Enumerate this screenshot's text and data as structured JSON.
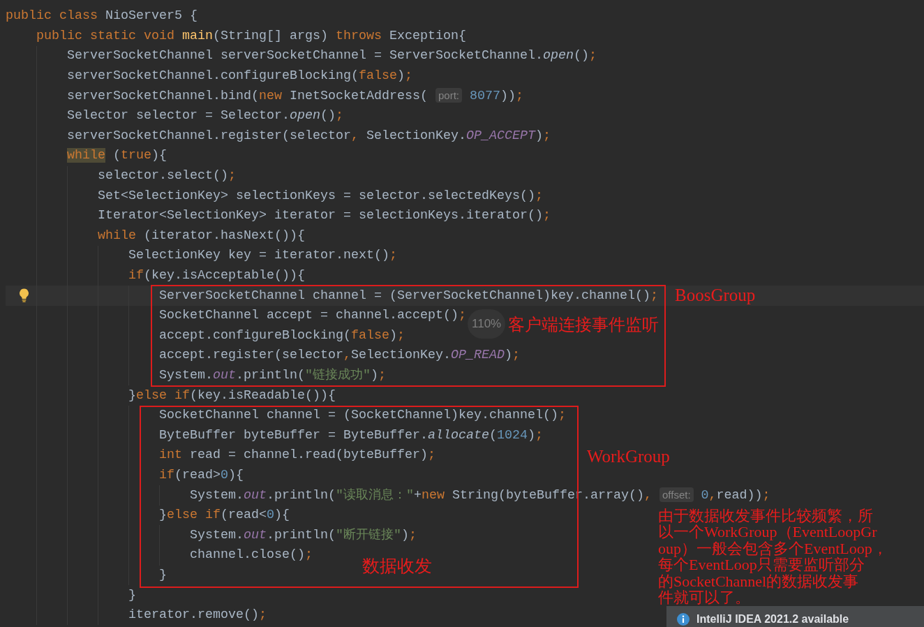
{
  "editor": {
    "lines": [
      {
        "current": false,
        "tokens": [
          {
            "kind": "keyword",
            "text": "public class"
          },
          {
            "kind": "plain",
            "text": " NioServer5 {"
          }
        ],
        "children": [
          {
            "current": false,
            "tokens": [
              {
                "kind": "keyword",
                "text": "public static void"
              },
              {
                "kind": "declaration",
                "text": " main"
              },
              {
                "kind": "plain",
                "text": "(String[] args) "
              },
              {
                "kind": "keyword",
                "text": "throws"
              },
              {
                "kind": "plain",
                "text": " Exception{"
              }
            ],
            "children": [
              {
                "current": false,
                "tokens": [
                  {
                    "kind": "plain",
                    "text": "ServerSocketChannel serverSocketChannel = ServerSocketChannel."
                  },
                  {
                    "kind": "static_call",
                    "text": "open"
                  },
                  {
                    "kind": "plain",
                    "text": "()"
                  },
                  {
                    "kind": "separator",
                    "text": ";"
                  }
                ]
              },
              {
                "current": false,
                "tokens": [
                  {
                    "kind": "plain",
                    "text": "serverSocketChannel.configureBlocking("
                  },
                  {
                    "kind": "keyword",
                    "text": "false"
                  },
                  {
                    "kind": "plain",
                    "text": ")"
                  },
                  {
                    "kind": "separator",
                    "text": ";"
                  }
                ]
              },
              {
                "current": false,
                "tokens": [
                  {
                    "kind": "plain",
                    "text": "serverSocketChannel.bind("
                  },
                  {
                    "kind": "keyword",
                    "text": "new"
                  },
                  {
                    "kind": "plain",
                    "text": " InetSocketAddress( "
                  },
                  {
                    "kind": "hint",
                    "text": "port:"
                  },
                  {
                    "kind": "number",
                    "text": " 8077"
                  },
                  {
                    "kind": "plain",
                    "text": "))"
                  },
                  {
                    "kind": "separator",
                    "text": ";"
                  }
                ]
              },
              {
                "current": false,
                "tokens": [
                  {
                    "kind": "plain",
                    "text": "Selector selector = Selector."
                  },
                  {
                    "kind": "static_call",
                    "text": "open"
                  },
                  {
                    "kind": "plain",
                    "text": "()"
                  },
                  {
                    "kind": "separator",
                    "text": ";"
                  }
                ]
              },
              {
                "current": false,
                "tokens": [
                  {
                    "kind": "plain",
                    "text": "serverSocketChannel.register(selector"
                  },
                  {
                    "kind": "separator",
                    "text": ","
                  },
                  {
                    "kind": "plain",
                    "text": " SelectionKey."
                  },
                  {
                    "kind": "field",
                    "text": "OP_ACCEPT"
                  },
                  {
                    "kind": "plain",
                    "text": ")"
                  },
                  {
                    "kind": "separator",
                    "text": ";"
                  }
                ]
              },
              {
                "current": false,
                "tokens": [
                  {
                    "kind": "keyword_marked",
                    "text": "while"
                  },
                  {
                    "kind": "plain",
                    "text": " ("
                  },
                  {
                    "kind": "keyword",
                    "text": "true"
                  },
                  {
                    "kind": "plain",
                    "text": "){"
                  }
                ],
                "children": [
                  {
                    "current": false,
                    "tokens": [
                      {
                        "kind": "plain",
                        "text": "selector.select()"
                      },
                      {
                        "kind": "separator",
                        "text": ";"
                      }
                    ]
                  },
                  {
                    "current": false,
                    "tokens": [
                      {
                        "kind": "plain",
                        "text": "Set<SelectionKey> selectionKeys = selector.selectedKeys()"
                      },
                      {
                        "kind": "separator",
                        "text": ";"
                      }
                    ]
                  },
                  {
                    "current": false,
                    "tokens": [
                      {
                        "kind": "plain",
                        "text": "Iterator<SelectionKey> iterator = selectionKeys.iterator()"
                      },
                      {
                        "kind": "separator",
                        "text": ";"
                      }
                    ]
                  },
                  {
                    "current": false,
                    "tokens": [
                      {
                        "kind": "keyword",
                        "text": "while"
                      },
                      {
                        "kind": "plain",
                        "text": " (iterator.hasNext()){"
                      }
                    ],
                    "children": [
                      {
                        "current": false,
                        "tokens": [
                          {
                            "kind": "plain",
                            "text": "SelectionKey key = iterator.next()"
                          },
                          {
                            "kind": "separator",
                            "text": ";"
                          }
                        ]
                      },
                      {
                        "current": false,
                        "tokens": [
                          {
                            "kind": "keyword",
                            "text": "if"
                          },
                          {
                            "kind": "plain",
                            "text": "(key.isAcceptable()){"
                          }
                        ],
                        "children": [
                          {
                            "current": true,
                            "tokens": [
                              {
                                "kind": "plain",
                                "text": "ServerSocketChannel channel = (ServerSocketChannel)key.channel()"
                              },
                              {
                                "kind": "separator",
                                "text": ";"
                              }
                            ]
                          },
                          {
                            "current": false,
                            "tokens": [
                              {
                                "kind": "plain",
                                "text": "SocketChannel accept = channel.accept()"
                              },
                              {
                                "kind": "separator",
                                "text": ";"
                              }
                            ]
                          },
                          {
                            "current": false,
                            "tokens": [
                              {
                                "kind": "plain",
                                "text": "accept.configureBlocking("
                              },
                              {
                                "kind": "keyword",
                                "text": "false"
                              },
                              {
                                "kind": "plain",
                                "text": ")"
                              },
                              {
                                "kind": "separator",
                                "text": ";"
                              }
                            ]
                          },
                          {
                            "current": false,
                            "tokens": [
                              {
                                "kind": "plain",
                                "text": "accept.register(selector"
                              },
                              {
                                "kind": "separator",
                                "text": ","
                              },
                              {
                                "kind": "plain",
                                "text": "SelectionKey."
                              },
                              {
                                "kind": "field",
                                "text": "OP_READ"
                              },
                              {
                                "kind": "plain",
                                "text": ")"
                              },
                              {
                                "kind": "separator",
                                "text": ";"
                              }
                            ]
                          },
                          {
                            "current": false,
                            "tokens": [
                              {
                                "kind": "plain",
                                "text": "System."
                              },
                              {
                                "kind": "field",
                                "text": "out"
                              },
                              {
                                "kind": "plain",
                                "text": ".println("
                              },
                              {
                                "kind": "string",
                                "text": "\"链接成功\""
                              },
                              {
                                "kind": "plain",
                                "text": ")"
                              },
                              {
                                "kind": "separator",
                                "text": ";"
                              }
                            ]
                          }
                        ]
                      },
                      {
                        "current": false,
                        "tokens": [
                          {
                            "kind": "plain",
                            "text": "}"
                          },
                          {
                            "kind": "keyword",
                            "text": "else if"
                          },
                          {
                            "kind": "plain",
                            "text": "(key.isReadable()){"
                          }
                        ],
                        "children": [
                          {
                            "current": false,
                            "tokens": [
                              {
                                "kind": "plain",
                                "text": "SocketChannel channel = (SocketChannel)key.channel()"
                              },
                              {
                                "kind": "separator",
                                "text": ";"
                              }
                            ]
                          },
                          {
                            "current": false,
                            "tokens": [
                              {
                                "kind": "plain",
                                "text": "ByteBuffer byteBuffer = ByteBuffer."
                              },
                              {
                                "kind": "static_call",
                                "text": "allocate"
                              },
                              {
                                "kind": "plain",
                                "text": "("
                              },
                              {
                                "kind": "number",
                                "text": "1024"
                              },
                              {
                                "kind": "plain",
                                "text": ")"
                              },
                              {
                                "kind": "separator",
                                "text": ";"
                              }
                            ]
                          },
                          {
                            "current": false,
                            "tokens": [
                              {
                                "kind": "keyword",
                                "text": "int"
                              },
                              {
                                "kind": "plain",
                                "text": " read = channel.read(byteBuffer)"
                              },
                              {
                                "kind": "separator",
                                "text": ";"
                              }
                            ]
                          },
                          {
                            "current": false,
                            "tokens": [
                              {
                                "kind": "keyword",
                                "text": "if"
                              },
                              {
                                "kind": "plain",
                                "text": "(read>"
                              },
                              {
                                "kind": "number",
                                "text": "0"
                              },
                              {
                                "kind": "plain",
                                "text": "){"
                              }
                            ],
                            "children": [
                              {
                                "current": false,
                                "tokens": [
                                  {
                                    "kind": "plain",
                                    "text": "System."
                                  },
                                  {
                                    "kind": "field",
                                    "text": "out"
                                  },
                                  {
                                    "kind": "plain",
                                    "text": ".println("
                                  },
                                  {
                                    "kind": "string",
                                    "text": "\"读取消息：\""
                                  },
                                  {
                                    "kind": "plain",
                                    "text": "+"
                                  },
                                  {
                                    "kind": "keyword",
                                    "text": "new"
                                  },
                                  {
                                    "kind": "plain",
                                    "text": " String(byteBuffer.array()"
                                  },
                                  {
                                    "kind": "separator",
                                    "text": ", "
                                  },
                                  {
                                    "kind": "hint",
                                    "text": "offset:"
                                  },
                                  {
                                    "kind": "number",
                                    "text": " 0"
                                  },
                                  {
                                    "kind": "separator",
                                    "text": ","
                                  },
                                  {
                                    "kind": "plain",
                                    "text": "read))"
                                  },
                                  {
                                    "kind": "separator",
                                    "text": ";"
                                  }
                                ]
                              }
                            ]
                          },
                          {
                            "current": false,
                            "tokens": [
                              {
                                "kind": "plain",
                                "text": "}"
                              },
                              {
                                "kind": "keyword",
                                "text": "else if"
                              },
                              {
                                "kind": "plain",
                                "text": "(read<"
                              },
                              {
                                "kind": "number",
                                "text": "0"
                              },
                              {
                                "kind": "plain",
                                "text": "){"
                              }
                            ],
                            "children": [
                              {
                                "current": false,
                                "tokens": [
                                  {
                                    "kind": "plain",
                                    "text": "System."
                                  },
                                  {
                                    "kind": "field",
                                    "text": "out"
                                  },
                                  {
                                    "kind": "plain",
                                    "text": ".println("
                                  },
                                  {
                                    "kind": "string",
                                    "text": "\"断开链接\""
                                  },
                                  {
                                    "kind": "plain",
                                    "text": ")"
                                  },
                                  {
                                    "kind": "separator",
                                    "text": ";"
                                  }
                                ]
                              },
                              {
                                "current": false,
                                "tokens": [
                                  {
                                    "kind": "plain",
                                    "text": "channel.close()"
                                  },
                                  {
                                    "kind": "separator",
                                    "text": ";"
                                  }
                                ]
                              }
                            ]
                          },
                          {
                            "current": false,
                            "tokens": [
                              {
                                "kind": "plain",
                                "text": "}"
                              }
                            ]
                          }
                        ]
                      },
                      {
                        "current": false,
                        "tokens": [
                          {
                            "kind": "plain",
                            "text": "}"
                          }
                        ]
                      },
                      {
                        "current": false,
                        "tokens": [
                          {
                            "kind": "plain",
                            "text": "iterator.remove()"
                          },
                          {
                            "kind": "separator",
                            "text": ";"
                          }
                        ]
                      }
                    ]
                  }
                ]
              }
            ]
          }
        ]
      }
    ]
  },
  "zoom_indicator": "110%",
  "annotations": {
    "boss_group": "BoosGroup",
    "accept_note": "客户端连接事件监听",
    "work_group": "WorkGroup",
    "io_note": "数据收发",
    "explanation": [
      "由于数据收发事件比较频繁，所",
      "以一个WorkGroup（EventLoopGr",
      "oup）一般会包含多个EventLoop，",
      "每个EventLoop只需要监听部分",
      "的SocketChannel的数据收发事",
      "件就可以了。"
    ]
  },
  "notification": {
    "title": "IntelliJ IDEA 2021.2 available"
  }
}
